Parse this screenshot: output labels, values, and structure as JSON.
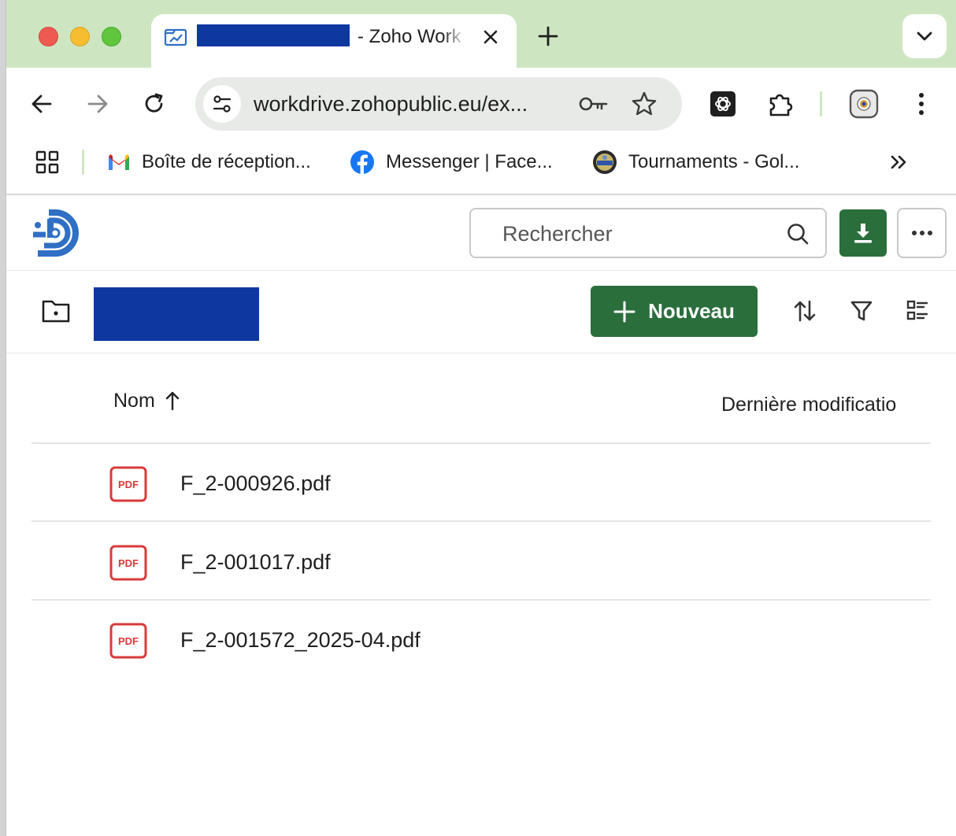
{
  "browser": {
    "tab": {
      "title": " - Zoho Work",
      "favicon": "workdrive-favicon"
    },
    "url": "workdrive.zohopublic.eu/ex...",
    "icons": [
      "back-icon",
      "forward-icon",
      "reload-icon",
      "site-info-icon",
      "password-key-icon",
      "bookmark-star-icon",
      "chatgpt-extension-icon",
      "extensions-puzzle-icon",
      "profile-avatar-icon",
      "browser-menu-icon"
    ],
    "bookmarks": [
      {
        "label": "Boîte de réception...",
        "icon": "gmail-icon"
      },
      {
        "label": "Messenger | Face...",
        "icon": "facebook-icon"
      },
      {
        "label": "Tournaments - Gol...",
        "icon": "golf-club-icon"
      }
    ]
  },
  "app": {
    "search_placeholder": "Rechercher",
    "new_button_label": "Nouveau",
    "columns": {
      "name": "Nom",
      "modified": "Dernière modificatio"
    },
    "files": [
      {
        "name": "F_2-000926.pdf",
        "type": "PDF"
      },
      {
        "name": "F_2-001017.pdf",
        "type": "PDF"
      },
      {
        "name": "F_2-001572_2025-04.pdf",
        "type": "PDF"
      }
    ]
  },
  "colors": {
    "tabstrip": "#cde6c1",
    "primary_green": "#2a6e3c",
    "redaction": "#0f37a0",
    "pdf_red": "#d93a3a",
    "logo_blue": "#2f6fc4"
  }
}
